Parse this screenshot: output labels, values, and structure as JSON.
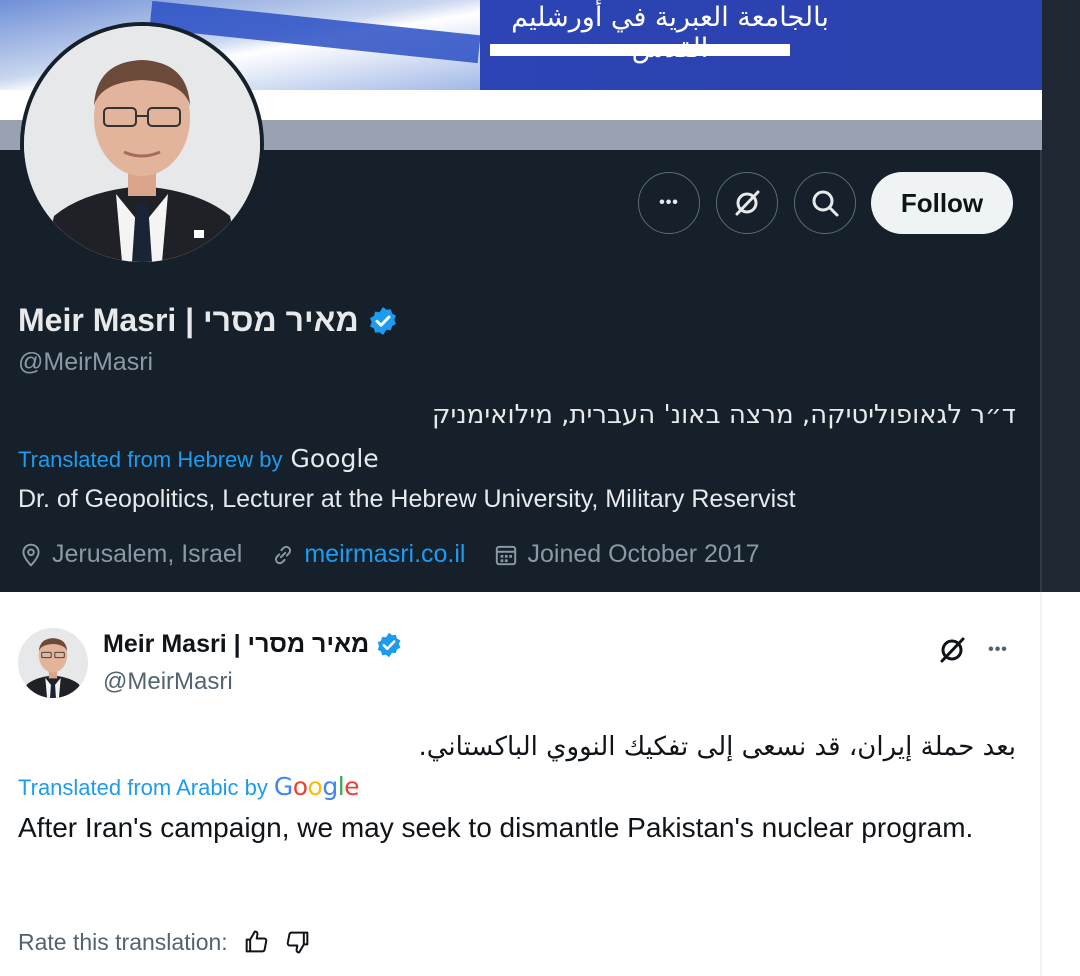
{
  "banner": {
    "arabic_text": "بالجامعة العبرية في أورشليم القدس"
  },
  "profile": {
    "display_name": "Meir Masri | מאיר מסרי",
    "handle": "@MeirMasri",
    "bio_hebrew": "ד״ר לגאופוליטיקה, מרצה באונ' העברית, מילואימניק",
    "translated_label": "Translated from Hebrew by",
    "google_label": "Google",
    "bio_english": "Dr. of Geopolitics, Lecturer at the Hebrew University, Military Reservist",
    "location": "Jerusalem, Israel",
    "website": "meirmasri.co.il",
    "joined": "Joined October 2017",
    "follow_label": "Follow",
    "more_label": "•••"
  },
  "tweet": {
    "display_name": "Meir Masri | מאיר מסרי",
    "handle": "@MeirMasri",
    "text_arabic": "بعد حملة إيران، قد نسعى إلى تفكيك النووي الباكستاني.",
    "translated_label": "Translated from Arabic by",
    "google_letters": [
      "G",
      "o",
      "o",
      "g",
      "l",
      "e"
    ],
    "text_english": "After Iran's campaign, we may seek to dismantle Pakistan's nuclear program.",
    "rate_label": "Rate this translation:",
    "more_label": "•••"
  },
  "colors": {
    "dark_bg": "#15202b",
    "accent": "#1d9bf0",
    "verified": "#1d9bf0",
    "google": [
      "#4285f4",
      "#ea4335",
      "#fbbc05",
      "#4285f4",
      "#34a853",
      "#ea4335"
    ]
  },
  "icons": {
    "more": "more-icon",
    "grok": "grok-icon",
    "search": "search-icon",
    "verified": "verified-badge-icon",
    "location": "location-pin-icon",
    "link": "link-icon",
    "calendar": "calendar-icon",
    "thumbs_up": "thumbs-up-icon",
    "thumbs_down": "thumbs-down-icon"
  }
}
